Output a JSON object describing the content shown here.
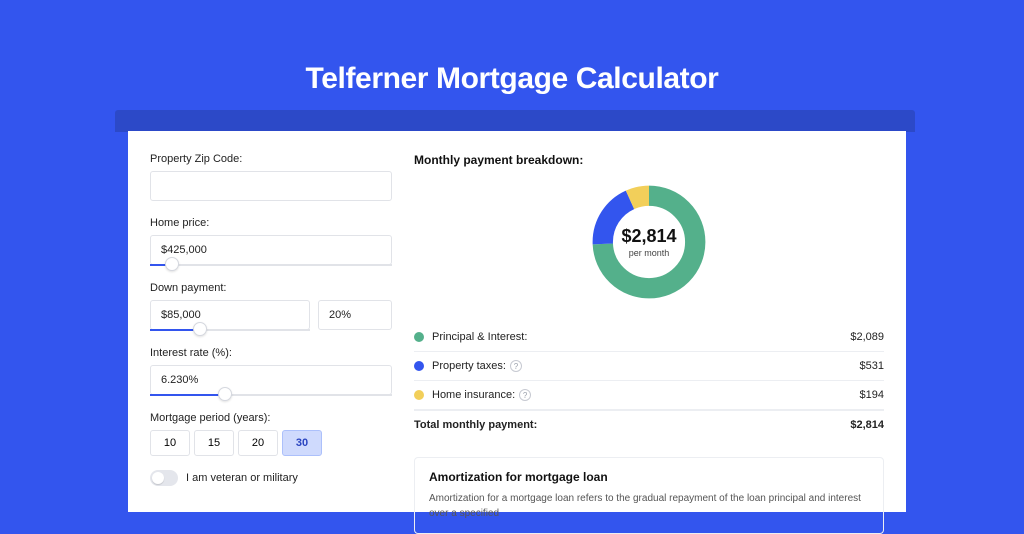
{
  "title": "Telferner Mortgage Calculator",
  "form": {
    "zip_label": "Property Zip Code:",
    "zip_value": "",
    "home_price_label": "Home price:",
    "home_price_value": "$425,000",
    "home_price_slider_percent": 9,
    "down_payment_label": "Down payment:",
    "down_payment_amount": "$85,000",
    "down_payment_percent": "20%",
    "down_payment_slider_percent": 20,
    "interest_label": "Interest rate (%):",
    "interest_value": "6.230%",
    "interest_slider_percent": 31,
    "mortgage_period_label": "Mortgage period (years):",
    "periods": [
      "10",
      "15",
      "20",
      "30"
    ],
    "period_selected": "30",
    "veteran_label": "I am veteran or military"
  },
  "breakdown": {
    "title": "Monthly payment breakdown:",
    "center_value": "$2,814",
    "center_sub": "per month",
    "rows": [
      {
        "color": "#54b08b",
        "label": "Principal & Interest:",
        "amount": "$2,089",
        "info": false
      },
      {
        "color": "#3355ee",
        "label": "Property taxes:",
        "amount": "$531",
        "info": true
      },
      {
        "color": "#f2cf5a",
        "label": "Home insurance:",
        "amount": "$194",
        "info": true
      }
    ],
    "total_label": "Total monthly payment:",
    "total_amount": "$2,814"
  },
  "chart_data": {
    "type": "pie",
    "title": "Monthly payment breakdown",
    "categories": [
      "Principal & Interest",
      "Property taxes",
      "Home insurance"
    ],
    "values": [
      2089,
      531,
      194
    ],
    "colors": [
      "#54b08b",
      "#3355ee",
      "#f2cf5a"
    ],
    "total": 2814,
    "center_label": "$2,814 per month"
  },
  "amortization": {
    "title": "Amortization for mortgage loan",
    "text": "Amortization for a mortgage loan refers to the gradual repayment of the loan principal and interest over a specified"
  }
}
